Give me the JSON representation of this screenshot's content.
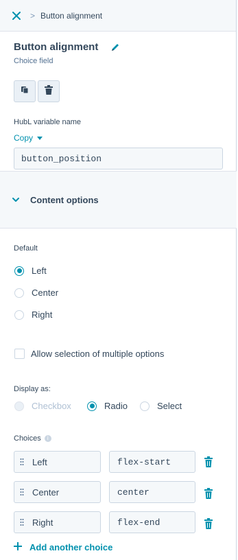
{
  "breadcrumb": {
    "separator": ">",
    "current": "Button alignment"
  },
  "field": {
    "title": "Button alignment",
    "subtitle": "Choice field",
    "hubl_label": "HubL variable name",
    "copy_label": "Copy",
    "variable_name": "button_position"
  },
  "section": {
    "label": "Content options"
  },
  "default": {
    "label": "Default",
    "options": [
      {
        "label": "Left",
        "selected": true
      },
      {
        "label": "Center",
        "selected": false
      },
      {
        "label": "Right",
        "selected": false
      }
    ]
  },
  "multiple": {
    "label": "Allow selection of multiple options",
    "checked": false
  },
  "display_as": {
    "label": "Display as:",
    "options": [
      {
        "label": "Checkbox",
        "selected": false,
        "disabled": true
      },
      {
        "label": "Radio",
        "selected": true,
        "disabled": false
      },
      {
        "label": "Select",
        "selected": false,
        "disabled": false
      }
    ]
  },
  "choices": {
    "label": "Choices",
    "info_glyph": "i",
    "items": [
      {
        "label": "Left",
        "value": "flex-start"
      },
      {
        "label": "Center",
        "value": "center"
      },
      {
        "label": "Right",
        "value": "flex-end"
      }
    ],
    "add_label": "Add another choice"
  },
  "colors": {
    "accent": "#0091ae",
    "text": "#33475b",
    "border": "#cbd6e2",
    "panel_bg": "#f5f8fa"
  }
}
